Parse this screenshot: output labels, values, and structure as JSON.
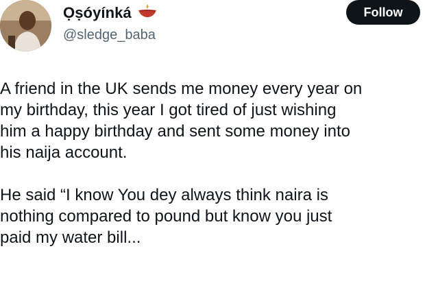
{
  "profile": {
    "display_name": "Ọṣóyínká",
    "handle": "@sledge_baba",
    "name_emoji": "diya-lamp-icon"
  },
  "actions": {
    "follow_label": "Follow"
  },
  "tweet": {
    "paragraphs": [
      "A friend in the UK sends me money every year on\nmy birthday, this year I got tired of just wishing\nhim a happy birthday and sent some money into\nhis naija account.",
      "He said “I know You dey always think naira is\nnothing compared to pound but know you just\npaid my water bill..."
    ]
  },
  "colors": {
    "text": "#0f1419",
    "secondary": "#536471",
    "button_bg": "#0f1419",
    "button_text": "#ffffff"
  }
}
